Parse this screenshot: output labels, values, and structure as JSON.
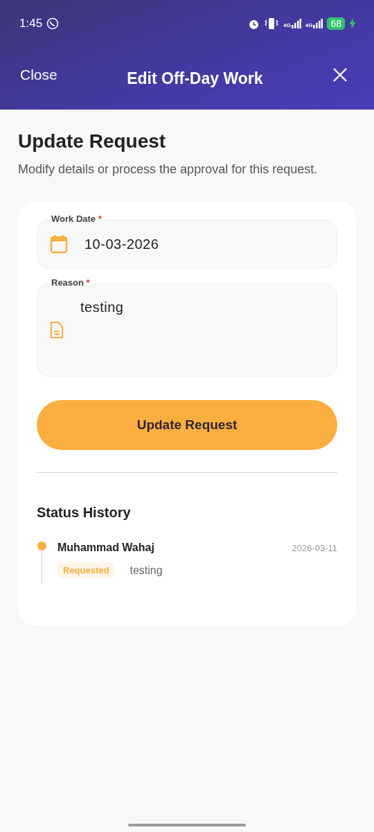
{
  "status_bar": {
    "time": "1:45",
    "networks": [
      "4G",
      "4G"
    ],
    "battery": "68",
    "charging": true
  },
  "header": {
    "close_label": "Close",
    "title": "Edit Off-Day Work"
  },
  "page": {
    "title": "Update Request",
    "subtitle": "Modify details or process the approval for this request."
  },
  "form": {
    "fields": [
      {
        "kind": "date",
        "label": "Work Date",
        "required_mark": "*",
        "value": "10-03-2026"
      },
      {
        "kind": "multiline",
        "label": "Reason",
        "required_mark": "*",
        "value": "testing"
      }
    ],
    "submit": "Update Request"
  },
  "status_history": {
    "title": "Status History",
    "entries": [
      {
        "name": "Muhammad Wahaj",
        "date": "2026-03-11",
        "status": "Requested",
        "note": "testing",
        "color": "#f9ae3f"
      }
    ]
  }
}
